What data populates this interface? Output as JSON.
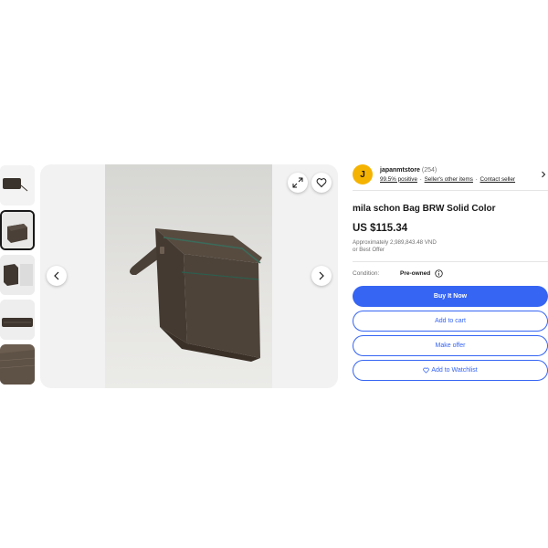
{
  "thumbnails": [
    {
      "name": "thumb-1",
      "active": false
    },
    {
      "name": "thumb-2",
      "active": true
    },
    {
      "name": "thumb-3",
      "active": false
    },
    {
      "name": "thumb-4",
      "active": false
    },
    {
      "name": "thumb-5",
      "active": false
    }
  ],
  "viewer": {
    "icons": [
      "expand-icon",
      "heart-icon",
      "chevron-left-icon",
      "chevron-right-icon"
    ]
  },
  "seller": {
    "avatar_letter": "J",
    "name": "japanmtstore",
    "count": "(254)",
    "positive": "99.5% positive",
    "other_items": "Seller's other items",
    "contact": "Contact seller"
  },
  "listing": {
    "title": "mila schon Bag BRW Solid Color",
    "price": "US $115.34",
    "approx_label": "Approximately",
    "approx_value": "2,989,843.48 VND",
    "best_offer": "or Best Offer",
    "condition_label": "Condition:",
    "condition_value": "Pre-owned"
  },
  "actions": {
    "buy_now": "Buy It Now",
    "add_to_cart": "Add to cart",
    "make_offer": "Make offer",
    "watchlist": "Add to Watchlist"
  },
  "colors": {
    "primary": "#3665f3",
    "avatar": "#f5b301",
    "text": "#191919",
    "muted": "#707070"
  }
}
